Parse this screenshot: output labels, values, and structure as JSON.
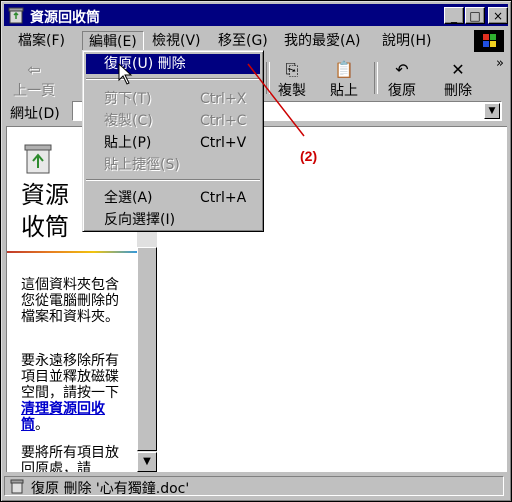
{
  "window": {
    "title": "資源回收筒"
  },
  "titlebar_buttons": {
    "minimize": "_",
    "maximize": "□",
    "close": "×"
  },
  "menubar": {
    "items": [
      {
        "label": "檔案(F)"
      },
      {
        "label": "編輯(E)"
      },
      {
        "label": "檢視(V)"
      },
      {
        "label": "移至(G)"
      },
      {
        "label": "我的最愛(A)"
      },
      {
        "label": "說明(H)"
      }
    ]
  },
  "toolbar": {
    "back": "上一頁",
    "copy": "複製",
    "paste": "貼上",
    "undo": "復原",
    "delete": "刪除",
    "more": "»"
  },
  "address": {
    "label": "網址(D)"
  },
  "edit_menu": {
    "items": [
      {
        "label": "復原(U) 刪除",
        "shortcut": "",
        "state": "highlighted"
      },
      {
        "label": "剪下(T)",
        "shortcut": "Ctrl+X",
        "state": "disabled"
      },
      {
        "label": "複製(C)",
        "shortcut": "Ctrl+C",
        "state": "disabled"
      },
      {
        "label": "貼上(P)",
        "shortcut": "Ctrl+V",
        "state": "enabled"
      },
      {
        "label": "貼上捷徑(S)",
        "shortcut": "",
        "state": "disabled"
      },
      {
        "label": "全選(A)",
        "shortcut": "Ctrl+A",
        "state": "enabled"
      },
      {
        "label": "反向選擇(I)",
        "shortcut": "",
        "state": "enabled"
      }
    ]
  },
  "left_pane": {
    "title_line1": "資源",
    "title_line2": "收筒",
    "para1": "這個資料夾包含您從電腦刪除的檔案和資料夾。",
    "para2_text": "要永遠移除所有項目並釋放磁碟空間，請按一下",
    "para2_link": "清理資源回收筒",
    "para2_end": "。",
    "para3": "要將所有項目放回原處，請"
  },
  "statusbar": {
    "text": "復原 刪除 '心有獨鐘.doc'"
  },
  "annotation": {
    "label": "(2)",
    "color": "#cc0000"
  },
  "colors": {
    "titlebar": "#000080",
    "face": "#c0c0c0",
    "highlight": "#000080"
  }
}
